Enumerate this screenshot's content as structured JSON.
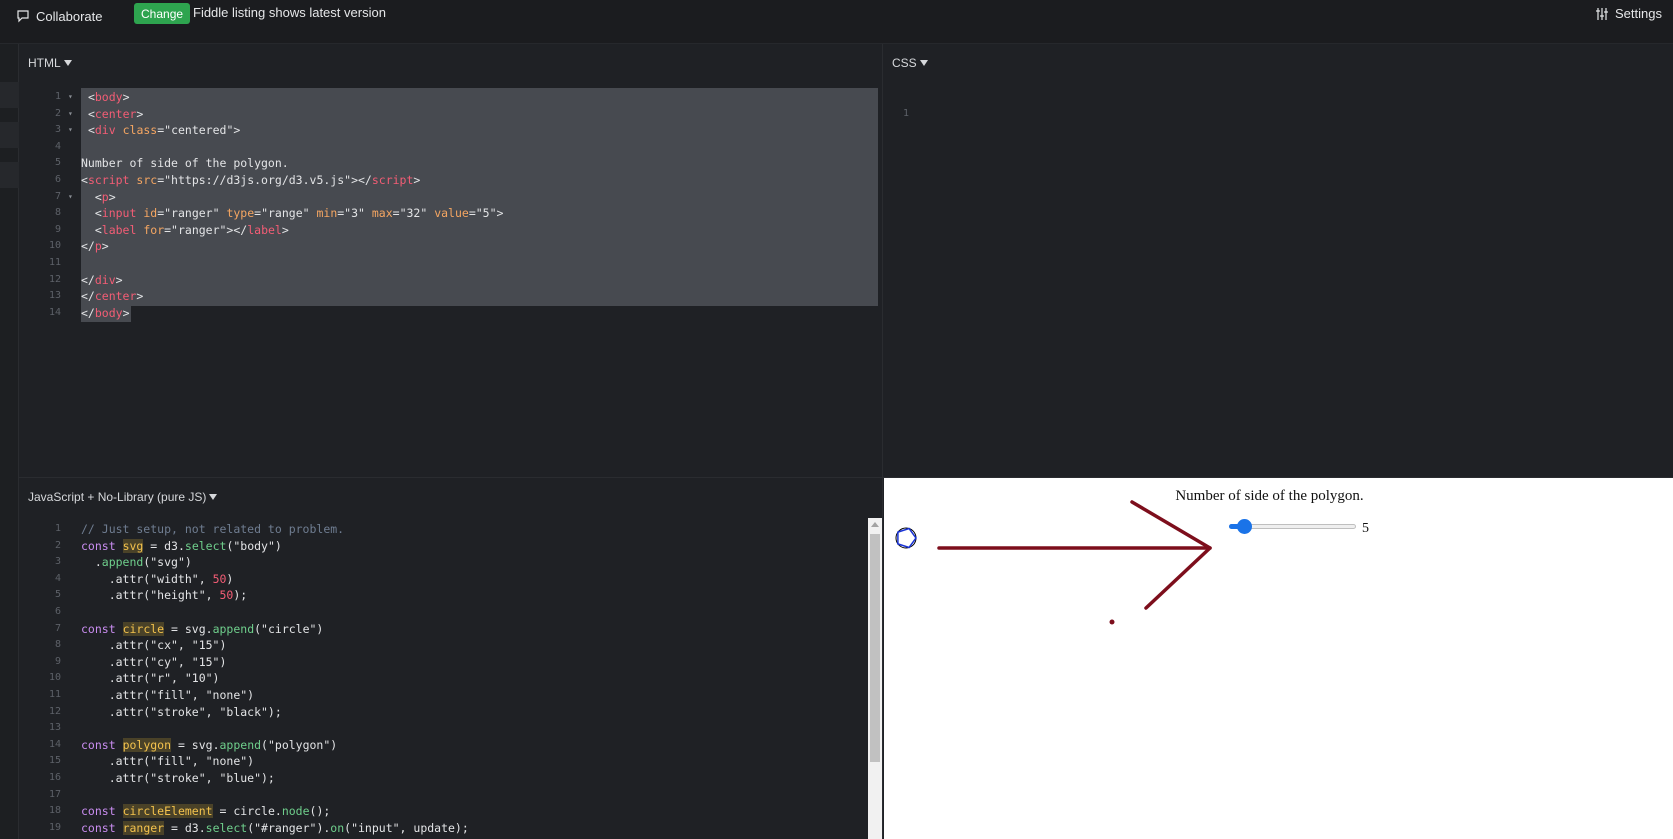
{
  "topbar": {
    "collaborate_label": "Collaborate",
    "change_badge": "Change",
    "notice": "Fiddle listing shows latest version",
    "settings_label": "Settings"
  },
  "panels": {
    "html_label": "HTML",
    "css_label": "CSS",
    "js_label": "JavaScript + No-Library (pure JS)"
  },
  "css_editor": {
    "line_numbers": [
      "1"
    ]
  },
  "result": {
    "title": "Number of side of the polygon.",
    "slider_min": 3,
    "slider_max": 32,
    "slider_value": 5,
    "value_label": "5",
    "annotation_color": "#7d0e1c"
  },
  "colors": {
    "accent_green": "#2ea44f",
    "slider_blue": "#1a73e8",
    "editor_bg": "#1f2125"
  },
  "html_editor": {
    "lines": [
      {
        "n": "1",
        "fold": true,
        "tokens": [
          {
            "t": " "
          },
          {
            "t": "<",
            "c": "t-plain"
          },
          {
            "t": "body",
            "c": "t-tag"
          },
          {
            "t": ">",
            "c": "t-plain"
          }
        ]
      },
      {
        "n": "2",
        "fold": true,
        "tokens": [
          {
            "t": " "
          },
          {
            "t": "<",
            "c": "t-plain"
          },
          {
            "t": "center",
            "c": "t-tag"
          },
          {
            "t": ">",
            "c": "t-plain"
          }
        ]
      },
      {
        "n": "3",
        "fold": true,
        "tokens": [
          {
            "t": " "
          },
          {
            "t": "<",
            "c": "t-plain"
          },
          {
            "t": "div",
            "c": "t-tag"
          },
          {
            "t": " "
          },
          {
            "t": "class",
            "c": "t-attr"
          },
          {
            "t": "=\"centered\">",
            "c": "t-plain"
          }
        ]
      },
      {
        "n": "4",
        "tokens": []
      },
      {
        "n": "5",
        "tokens": [
          {
            "t": "Number of side of the polygon.",
            "c": "t-plain"
          }
        ]
      },
      {
        "n": "6",
        "tokens": [
          {
            "t": "<",
            "c": "t-plain"
          },
          {
            "t": "script",
            "c": "t-tag"
          },
          {
            "t": " "
          },
          {
            "t": "src",
            "c": "t-attr"
          },
          {
            "t": "=\"https://d3js.org/d3.v5.js\"></",
            "c": "t-plain"
          },
          {
            "t": "script",
            "c": "t-tag"
          },
          {
            "t": ">",
            "c": "t-plain"
          }
        ]
      },
      {
        "n": "7",
        "fold": true,
        "tokens": [
          {
            "t": "  <",
            "c": "t-plain"
          },
          {
            "t": "p",
            "c": "t-tag"
          },
          {
            "t": ">",
            "c": "t-plain"
          }
        ]
      },
      {
        "n": "8",
        "tokens": [
          {
            "t": "  <",
            "c": "t-plain"
          },
          {
            "t": "input",
            "c": "t-tag"
          },
          {
            "t": " "
          },
          {
            "t": "id",
            "c": "t-attr"
          },
          {
            "t": "=\"ranger\" ",
            "c": "t-plain"
          },
          {
            "t": "type",
            "c": "t-attr"
          },
          {
            "t": "=\"range\" ",
            "c": "t-plain"
          },
          {
            "t": "min",
            "c": "t-attr"
          },
          {
            "t": "=\"3\" ",
            "c": "t-plain"
          },
          {
            "t": "max",
            "c": "t-attr"
          },
          {
            "t": "=\"32\" ",
            "c": "t-plain"
          },
          {
            "t": "value",
            "c": "t-attr"
          },
          {
            "t": "=\"5\">",
            "c": "t-plain"
          }
        ]
      },
      {
        "n": "9",
        "tokens": [
          {
            "t": "  <",
            "c": "t-plain"
          },
          {
            "t": "label",
            "c": "t-tag"
          },
          {
            "t": " "
          },
          {
            "t": "for",
            "c": "t-attr"
          },
          {
            "t": "=\"ranger\"></",
            "c": "t-plain"
          },
          {
            "t": "label",
            "c": "t-tag"
          },
          {
            "t": ">",
            "c": "t-plain"
          }
        ]
      },
      {
        "n": "10",
        "tokens": [
          {
            "t": "</",
            "c": "t-plain"
          },
          {
            "t": "p",
            "c": "t-tag"
          },
          {
            "t": ">",
            "c": "t-plain"
          }
        ]
      },
      {
        "n": "11",
        "tokens": []
      },
      {
        "n": "12",
        "tokens": [
          {
            "t": "</",
            "c": "t-plain"
          },
          {
            "t": "div",
            "c": "t-tag"
          },
          {
            "t": ">",
            "c": "t-plain"
          }
        ]
      },
      {
        "n": "13",
        "tokens": [
          {
            "t": "</",
            "c": "t-plain"
          },
          {
            "t": "center",
            "c": "t-tag"
          },
          {
            "t": ">",
            "c": "t-plain"
          }
        ]
      },
      {
        "n": "14",
        "tokens": [
          {
            "t": "</",
            "c": "t-plain"
          },
          {
            "t": "body",
            "c": "t-tag"
          },
          {
            "t": ">",
            "c": "t-plain"
          }
        ]
      }
    ]
  },
  "js_editor": {
    "lines": [
      {
        "n": "1",
        "tokens": [
          {
            "t": "// Just setup, not related to problem.",
            "c": "t-cmt"
          }
        ]
      },
      {
        "n": "2",
        "tokens": [
          {
            "t": "const",
            "c": "t-kw"
          },
          {
            "t": " "
          },
          {
            "t": "svg",
            "c": "t-var t-hl"
          },
          {
            "t": " = d3.",
            "c": "t-plain"
          },
          {
            "t": "select",
            "c": "t-fn"
          },
          {
            "t": "(\"body\")",
            "c": "t-plain"
          }
        ]
      },
      {
        "n": "3",
        "tokens": [
          {
            "t": "  .",
            "c": "t-plain"
          },
          {
            "t": "append",
            "c": "t-fn"
          },
          {
            "t": "(\"svg\")",
            "c": "t-plain"
          }
        ]
      },
      {
        "n": "4",
        "tokens": [
          {
            "t": "    .attr(\"width\", ",
            "c": "t-plain"
          },
          {
            "t": "50",
            "c": "t-num"
          },
          {
            "t": ")",
            "c": "t-plain"
          }
        ]
      },
      {
        "n": "5",
        "tokens": [
          {
            "t": "    .attr(\"height\", ",
            "c": "t-plain"
          },
          {
            "t": "50",
            "c": "t-num"
          },
          {
            "t": ");",
            "c": "t-plain"
          }
        ]
      },
      {
        "n": "6",
        "tokens": []
      },
      {
        "n": "7",
        "tokens": [
          {
            "t": "const",
            "c": "t-kw"
          },
          {
            "t": " "
          },
          {
            "t": "circle",
            "c": "t-var t-hl"
          },
          {
            "t": " = svg.",
            "c": "t-plain"
          },
          {
            "t": "append",
            "c": "t-fn"
          },
          {
            "t": "(\"circle\")",
            "c": "t-plain"
          }
        ]
      },
      {
        "n": "8",
        "tokens": [
          {
            "t": "    .attr(\"cx\", \"15\")",
            "c": "t-plain"
          }
        ]
      },
      {
        "n": "9",
        "tokens": [
          {
            "t": "    .attr(\"cy\", \"15\")",
            "c": "t-plain"
          }
        ]
      },
      {
        "n": "10",
        "tokens": [
          {
            "t": "    .attr(\"r\", \"10\")",
            "c": "t-plain"
          }
        ]
      },
      {
        "n": "11",
        "tokens": [
          {
            "t": "    .attr(\"fill\", \"none\")",
            "c": "t-plain"
          }
        ]
      },
      {
        "n": "12",
        "tokens": [
          {
            "t": "    .attr(\"stroke\", \"black\");",
            "c": "t-plain"
          }
        ]
      },
      {
        "n": "13",
        "tokens": []
      },
      {
        "n": "14",
        "tokens": [
          {
            "t": "const",
            "c": "t-kw"
          },
          {
            "t": " "
          },
          {
            "t": "polygon",
            "c": "t-var t-hl"
          },
          {
            "t": " = svg.",
            "c": "t-plain"
          },
          {
            "t": "append",
            "c": "t-fn"
          },
          {
            "t": "(\"polygon\")",
            "c": "t-plain"
          }
        ]
      },
      {
        "n": "15",
        "tokens": [
          {
            "t": "    .attr(\"fill\", \"none\")",
            "c": "t-plain"
          }
        ]
      },
      {
        "n": "16",
        "tokens": [
          {
            "t": "    .attr(\"stroke\", \"blue\");",
            "c": "t-plain"
          }
        ]
      },
      {
        "n": "17",
        "tokens": []
      },
      {
        "n": "18",
        "tokens": [
          {
            "t": "const",
            "c": "t-kw"
          },
          {
            "t": " "
          },
          {
            "t": "circleElement",
            "c": "t-var t-hl"
          },
          {
            "t": " = circle.",
            "c": "t-plain"
          },
          {
            "t": "node",
            "c": "t-fn"
          },
          {
            "t": "();",
            "c": "t-plain"
          }
        ]
      },
      {
        "n": "19",
        "tokens": [
          {
            "t": "const",
            "c": "t-kw"
          },
          {
            "t": " "
          },
          {
            "t": "ranger",
            "c": "t-var t-hl"
          },
          {
            "t": " = d3.",
            "c": "t-plain"
          },
          {
            "t": "select",
            "c": "t-fn"
          },
          {
            "t": "(\"#ranger\").",
            "c": "t-plain"
          },
          {
            "t": "on",
            "c": "t-fn"
          },
          {
            "t": "(\"input\", update);",
            "c": "t-plain"
          }
        ]
      }
    ]
  }
}
